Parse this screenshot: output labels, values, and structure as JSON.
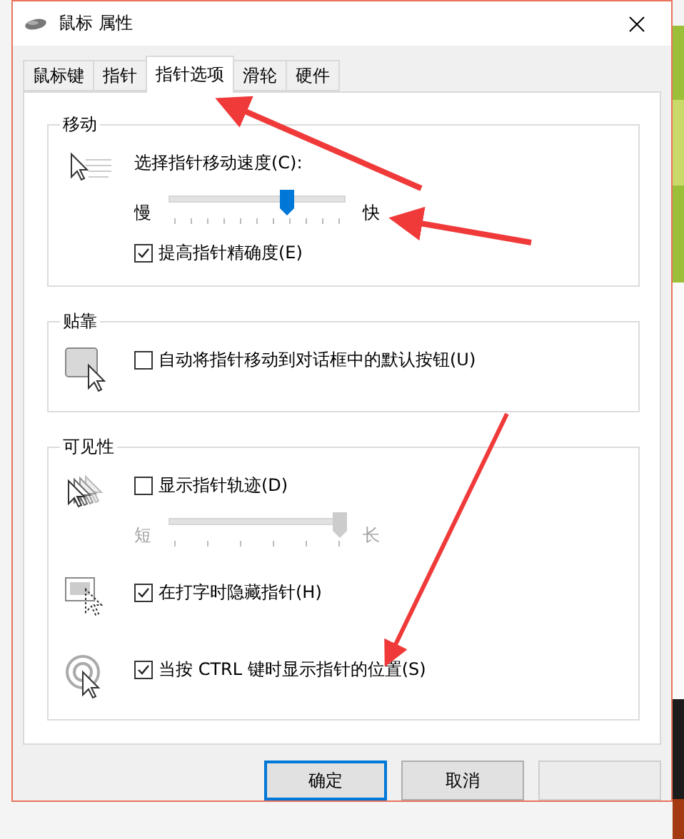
{
  "window": {
    "title": "鼠标 属性"
  },
  "tabs": [
    {
      "label": "鼠标键",
      "selected": false
    },
    {
      "label": "指针",
      "selected": false
    },
    {
      "label": "指针选项",
      "selected": true
    },
    {
      "label": "滑轮",
      "selected": false
    },
    {
      "label": "硬件",
      "selected": false
    }
  ],
  "groups": [
    {
      "title": "移动",
      "sections": [
        {
          "rows": [
            {
              "kind": "label",
              "text": "选择指针移动速度(C):"
            },
            {
              "kind": "slider",
              "min_label": "慢",
              "max_label": "快",
              "level": 0.68,
              "disabled": false
            },
            {
              "kind": "checkbox",
              "label": "提高指针精确度(E)",
              "checked": true
            }
          ]
        }
      ]
    },
    {
      "title": "贴靠",
      "sections": [
        {
          "rows": [
            {
              "kind": "checkbox",
              "label": "自动将指针移动到对话框中的默认按钮(U)",
              "checked": false
            }
          ]
        }
      ]
    },
    {
      "title": "可见性",
      "sections": [
        {
          "rows": [
            {
              "kind": "checkbox",
              "label": "显示指针轨迹(D)",
              "checked": false
            },
            {
              "kind": "slider",
              "min_label": "短",
              "max_label": "长",
              "level": 1,
              "disabled": true
            }
          ]
        },
        {
          "rows": [
            {
              "kind": "checkbox",
              "label": "在打字时隐藏指针(H)",
              "checked": true
            }
          ]
        },
        {
          "rows": [
            {
              "kind": "checkbox",
              "label": "当按 CTRL 键时显示指针的位置(S)",
              "checked": true
            }
          ]
        }
      ]
    }
  ],
  "buttons": [
    {
      "label": "确定",
      "default": true,
      "disabled": false
    },
    {
      "label": "取消",
      "default": false,
      "disabled": false
    },
    {
      "default": false,
      "disabled": true
    }
  ]
}
